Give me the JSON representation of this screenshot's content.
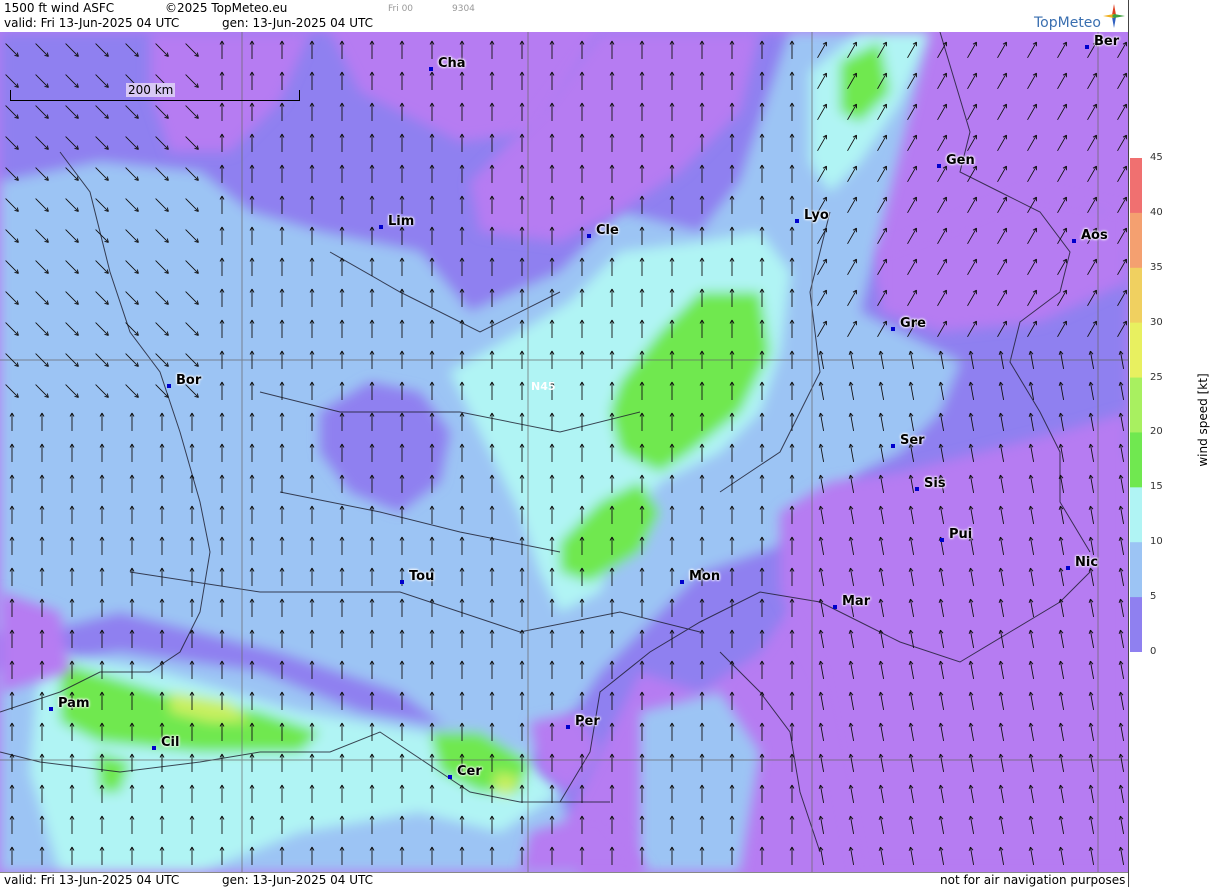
{
  "header": {
    "product": "1500 ft wind ASFC",
    "copyright": "©2025 TopMeteo.eu",
    "run": "Fri 00",
    "code": "9304",
    "valid": "valid:  Fri  13-Jun-2025  04 UTC",
    "gen": "gen: 13-Jun-2025 04 UTC",
    "logo": "TopMeteo"
  },
  "map": {
    "scale_label": "200 km",
    "latitude_label": "N45",
    "cities": [
      {
        "label": "Cha"
      },
      {
        "label": "Ber"
      },
      {
        "label": "Gen"
      },
      {
        "label": "Lim"
      },
      {
        "label": "Cle"
      },
      {
        "label": "Lyo"
      },
      {
        "label": "Aos"
      },
      {
        "label": "Gre"
      },
      {
        "label": "Bor"
      },
      {
        "label": "Ser"
      },
      {
        "label": "Sis"
      },
      {
        "label": "Pui"
      },
      {
        "label": "Tou"
      },
      {
        "label": "Mon"
      },
      {
        "label": "Nic"
      },
      {
        "label": "Mar"
      },
      {
        "label": "Pam"
      },
      {
        "label": "Per"
      },
      {
        "label": "Cil"
      },
      {
        "label": "Cer"
      }
    ]
  },
  "colorbar": {
    "title": "wind speed [kt]",
    "ticks": [
      "45",
      "40",
      "35",
      "30",
      "25",
      "20",
      "15",
      "10",
      "5",
      "0"
    ],
    "colors": [
      "#f07070",
      "#f4a070",
      "#f0d060",
      "#e8f060",
      "#a8f060",
      "#70e850",
      "#b0f4f4",
      "#9cc4f4",
      "#8f80f0",
      "#b67cf2"
    ]
  },
  "footer": {
    "valid": "valid:  Fri  13-Jun-2025  04 UTC",
    "gen": "gen: 13-Jun-2025 04 UTC",
    "disclaimer": "not for air navigation purposes"
  }
}
